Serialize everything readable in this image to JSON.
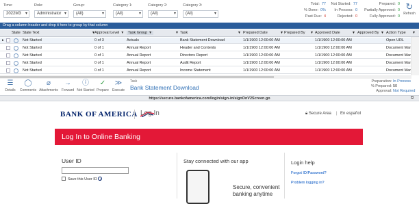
{
  "filters": [
    {
      "label": "Time:",
      "value": "2022M3"
    },
    {
      "label": "Role:",
      "value": "Administrator"
    },
    {
      "label": "Group:",
      "value": "(All)"
    },
    {
      "label": "Category 1:",
      "value": "(All)"
    },
    {
      "label": "Category 2:",
      "value": "(All)"
    },
    {
      "label": "Category 3:",
      "value": "(All)"
    }
  ],
  "stats": {
    "total_label": "Total:",
    "total": "77",
    "pct_done_label": "% Done:",
    "pct_done": "0%",
    "past_due_label": "Past Due:",
    "past_due": "4",
    "not_started_label": "Not Started:",
    "not_started": "77",
    "in_process_label": "In Process:",
    "in_process": "0",
    "rejected_label": "Rejected:",
    "rejected": "0",
    "prepared_label": "Prepared:",
    "prepared": "0",
    "partially_approved_label": "Partially Approved:",
    "partially_approved": "0",
    "fully_approved_label": "Fully Approved:",
    "fully_approved": "0",
    "refresh_label": "Refresh"
  },
  "group_bar": "Drag a column header and drop it here to group by that column",
  "columns": [
    "State",
    "State Text",
    "Approval Level",
    "Task Group",
    "Task",
    "Prepared Date",
    "Prepared By",
    "Approved Date",
    "Approved By",
    "Action Type"
  ],
  "rows": [
    {
      "marker": "▸",
      "state_text": "Not Started",
      "approval": "0 of 3",
      "group": "Actuals",
      "task": "Bank Statement Download",
      "prepared_date": "1/1/1900 12:00:00 AM",
      "prepared_by": "",
      "approved_date": "1/1/1900 12:00:00 AM",
      "approved_by": "",
      "action": "Open URL"
    },
    {
      "marker": "",
      "state_text": "Not Started",
      "approval": "0 of 1",
      "group": "Annual Report",
      "task": "Header and Contents",
      "prepared_date": "1/1/1900 12:00:00 AM",
      "prepared_by": "",
      "approved_date": "1/1/1900 12:00:00 AM",
      "approved_by": "",
      "action": "Document Mana"
    },
    {
      "marker": "",
      "state_text": "Not Started",
      "approval": "0 of 1",
      "group": "Annual Report",
      "task": "Directors Report",
      "prepared_date": "1/1/1900 12:00:00 AM",
      "prepared_by": "",
      "approved_date": "1/1/1900 12:00:00 AM",
      "approved_by": "",
      "action": "Document Mana"
    },
    {
      "marker": "",
      "state_text": "Not Started",
      "approval": "0 of 1",
      "group": "Annual Report",
      "task": "Audit Report",
      "prepared_date": "1/1/1900 12:00:00 AM",
      "prepared_by": "",
      "approved_date": "1/1/1900 12:00:00 AM",
      "approved_by": "",
      "action": "Document Mana"
    },
    {
      "marker": "",
      "state_text": "Not Started",
      "approval": "0 of 1",
      "group": "Annual Report",
      "task": "Income Statement",
      "prepared_date": "1/1/1900 12:00:00 AM",
      "prepared_by": "",
      "approved_date": "1/1/1900 12:00:00 AM",
      "approved_by": "",
      "action": "Document Mana"
    }
  ],
  "toolbar": [
    "Details",
    "Comments",
    "Attachments",
    "Forward",
    "Not Started",
    "Prepare",
    "Execute"
  ],
  "task_panel": {
    "label": "Task",
    "name": "Bank Statement Download"
  },
  "right_status": {
    "prep_label": "Preparation:",
    "prep_value": "In Process",
    "pct_label": "% Prepared:",
    "pct_value": "50",
    "appr_label": "Approval:",
    "appr_value": "Not Required"
  },
  "url": "https://secure.bankofamerica.com/login/sign-in/signOnV2Screen.go",
  "web": {
    "brand": "BANK OF AMERICA",
    "login": "Log In",
    "secure": "Secure Area",
    "lang": "En español",
    "banner": "Log In to Online Banking",
    "userid_label": "User ID",
    "save_label": "Save this User ID",
    "stay_connected": "Stay connected with our app",
    "promo1": "Secure, convenient",
    "promo2": "banking anytime",
    "help_title": "Login help",
    "forgot": "Forgot ID/Password?",
    "problems": "Problem logging in?"
  },
  "colors": {
    "accent": "#2a5c9a",
    "boa_red": "#e31837",
    "boa_navy": "#012169",
    "past_due": "#d2392c"
  }
}
